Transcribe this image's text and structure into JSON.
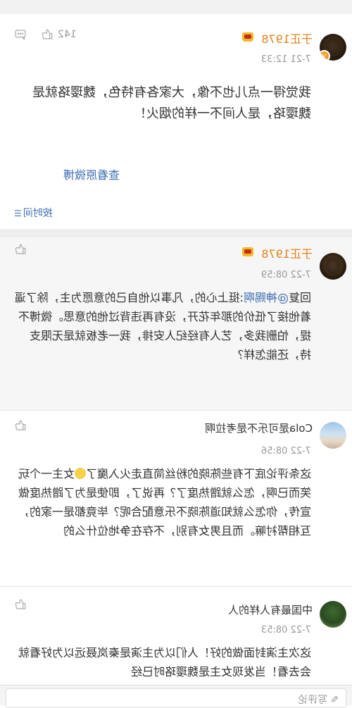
{
  "comments": [
    {
      "username": "于正1978",
      "time": "7-21 12:33",
      "likes": "142",
      "text": "我觉得一点儿也不像，大家各有特色，魏璎珞就是魏璎珞，是人间不一样的烟火！",
      "link": "查看原微博"
    },
    {
      "username": "于正1978",
      "time": "7-22 08:59",
      "reply_prefix": "回复",
      "mention": "@神赐啊",
      "text": ":挺上心的，凡事以他自己的意愿为主，除了逼着他接了低价的那年花开，没有再违背过他的意思。微博不提，怕删我多，艺人有经纪人安排，我一老板就是无限支持，还能怎样？"
    },
    {
      "username": "Cola是可乐不是考拉啊",
      "time": "7-22 08:56",
      "text_a": "这条评论底下有些陈晓的粉丝简直走火入魔了",
      "text_b": "女主一个玩笑而已啊，怎么就蹭热度了？再说了，即使是为了蹭热度做宣传，你怎么就知道陈晓不乐意配合呢？毕竟都是一家的，互相帮衬嘛。而且男女有别，不存在争地位什么的"
    },
    {
      "username": "中国最有人样的人",
      "time": "7-22 08:53",
      "text": "这次主演封面做的好！人们以为主演是秦岚聂远以为好看就会去看！当发现女主是魏璎珞时已经"
    }
  ],
  "sort": {
    "label": "按时间"
  },
  "input": {
    "placeholder": "写评论"
  },
  "colors": {
    "username": "#e2821b",
    "link": "#3e6fb3",
    "meta": "#999999"
  }
}
